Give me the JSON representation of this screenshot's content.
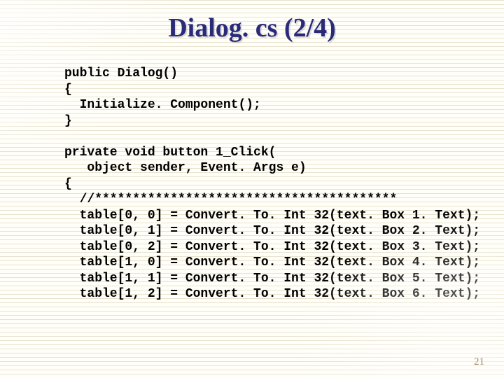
{
  "title": "Dialog. cs (2/4)",
  "code_lines": {
    "l0": "public Dialog()",
    "l1": "{",
    "l2": "  Initialize. Component();",
    "l3": "}",
    "l4": "",
    "l5": "private void button 1_Click(",
    "l6": "   object sender, Event. Args e)",
    "l7": "{",
    "l8": "  //****************************************",
    "l9": "  table[0, 0] = Convert. To. Int 32(text. Box 1. Text);",
    "l10": "  table[0, 1] = Convert. To. Int 32(text. Box 2. Text);",
    "l11": "  table[0, 2] = Convert. To. Int 32(text. Box 3. Text);",
    "l12": "  table[1, 0] = Convert. To. Int 32(text. Box 4. Text);",
    "l13": "  table[1, 1] = Convert. To. Int 32(text. Box 5. Text);",
    "l14": "  table[1, 2] = Convert. To. Int 32(text. Box 6. Text);"
  },
  "page_number": "21"
}
